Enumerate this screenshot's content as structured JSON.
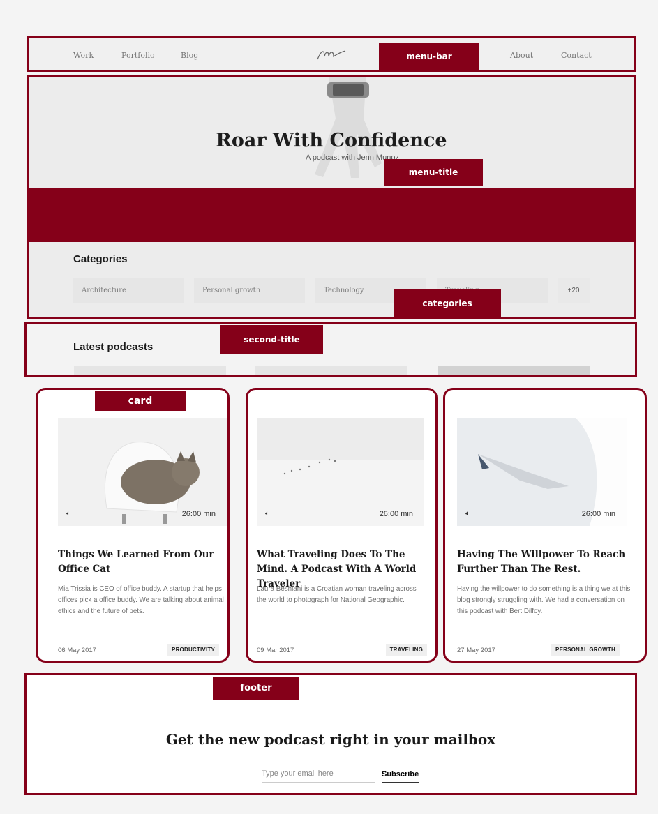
{
  "annotations": {
    "menu_bar": "menu-bar",
    "menu_title": "menu-title",
    "categories": "categories",
    "second_title": "second-title",
    "card": "card",
    "footer": "footer"
  },
  "nav": {
    "left": [
      "Work",
      "Portfolio",
      "Blog"
    ],
    "right": [
      "About",
      "Contact"
    ]
  },
  "hero": {
    "title": "Roar With Confidence",
    "subtitle": "A podcast with Jenn Munoz"
  },
  "categories": {
    "title": "Categories",
    "items": [
      "Architecture",
      "Personal growth",
      "Technology",
      "Traveling"
    ],
    "more": "+20"
  },
  "latest": {
    "title": "Latest podcasts"
  },
  "cards": [
    {
      "duration": "26:00 min",
      "title": "Things We Learned From Our Office Cat",
      "description": "Mia Trissia is CEO of office buddy. A startup that helps offices pick a office buddy. We are talking about animal ethics and the future of pets.",
      "date": "06 May 2017",
      "tag": "PRODUCTIVITY"
    },
    {
      "duration": "26:00 min",
      "title": "What Traveling Does To The Mind. A Podcast With A World Traveler",
      "description": "Laura Beshiani is a Croatian woman traveling across the world to photograph for National Geographic.",
      "date": "09 Mar 2017",
      "tag": "TRAVELING"
    },
    {
      "duration": "26:00 min",
      "title": "Having The Willpower To Reach Further Than The Rest.",
      "description": "Having the willpower to do something is a thing we at this blog strongly struggling with. We had a conversation on this podcast with Bert Dilfoy.",
      "date": "27 May 2017",
      "tag": "PERSONAL GROWTH"
    }
  ],
  "footer": {
    "title": "Get the new podcast right in your mailbox",
    "email_placeholder": "Type your email here",
    "subscribe_label": "Subscribe"
  },
  "colors": {
    "accent": "#850019"
  }
}
